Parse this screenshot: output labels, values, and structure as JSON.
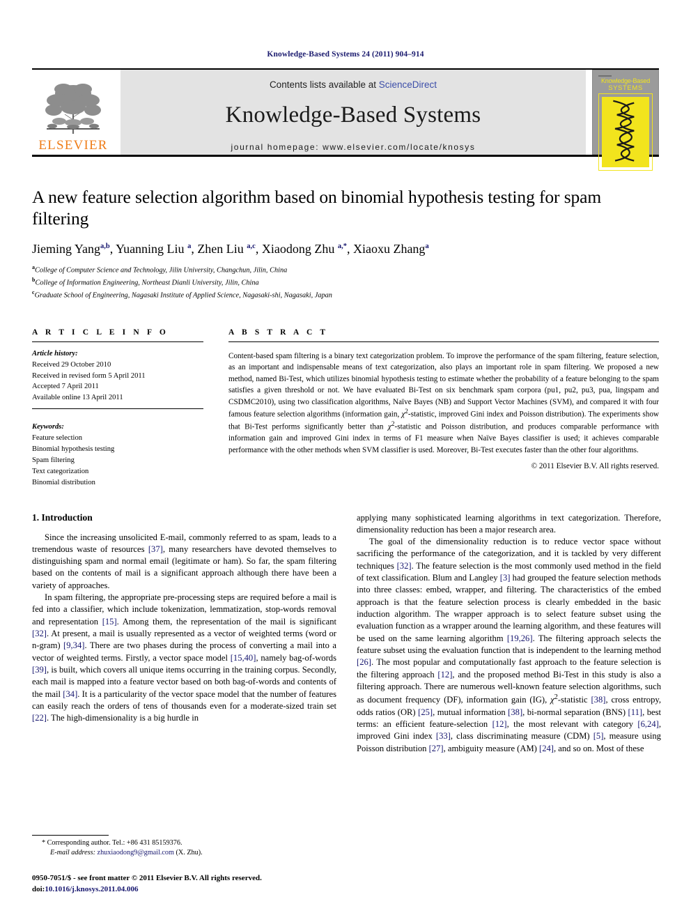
{
  "running_head": "Knowledge-Based Systems 24 (2011) 904–914",
  "masthead": {
    "contents_prefix": "Contents lists available at ",
    "sciencedirect": "ScienceDirect",
    "journal_name": "Knowledge-Based Systems",
    "homepage": "journal homepage: www.elsevier.com/locate/knosys",
    "publisher_wordmark": "ELSEVIER",
    "cover": {
      "line1": "Knowledge-Based",
      "line2": "SYSTEMS"
    }
  },
  "article": {
    "title": "A new feature selection algorithm based on binomial hypothesis testing for spam filtering",
    "authors_html": "Jieming Yang <sup>a,b</sup>, Yuanning Liu <sup>a</sup>, Zhen Liu <sup>a,c</sup>, Xiaodong Zhu <sup>a,</sup><sup>*</sup>, Xiaoxu Zhang <sup>a</sup>",
    "affiliations": [
      "College of Computer Science and Technology, Jilin University, Changchun, Jilin, China",
      "College of Information Engineering, Northeast Dianli University, Jilin, China",
      "Graduate School of Engineering, Nagasaki Institute of Applied Science, Nagasaki-shi, Nagasaki, Japan"
    ],
    "affiliation_marks": [
      "a",
      "b",
      "c"
    ]
  },
  "info": {
    "heading": "A R T I C L E   I N F O",
    "history_label": "Article history:",
    "history": [
      "Received 29 October 2010",
      "Received in revised form 5 April 2011",
      "Accepted 7 April 2011",
      "Available online 13 April 2011"
    ],
    "keywords_label": "Keywords:",
    "keywords": [
      "Feature selection",
      "Binomial hypothesis testing",
      "Spam filtering",
      "Text categorization",
      "Binomial distribution"
    ]
  },
  "abstract": {
    "heading": "A B S T R A C T",
    "text_html": "Content-based spam filtering is a binary text categorization problem. To improve the performance of the spam filtering, feature selection, as an important and indispensable means of text categorization, also plays an important role in spam filtering. We proposed a new method, named Bi-Test, which utilizes binomial hypothesis testing to estimate whether the probability of a feature belonging to the spam satisfies a given threshold or not. We have evaluated Bi-Test on six benchmark spam corpora (pu1, pu2, pu3, pua, lingspam and CSDMC2010), using two classification algorithms, Naïve Bayes (NB) and Support Vector Machines (SVM), and compared it with four famous feature selection algorithms (information gain, <span class=\"chi\">&chi;</span><sup>2</sup>-statistic, improved Gini index and Poisson distribution). The experiments show that Bi-Test performs significantly better than <span class=\"chi\">&chi;</span><sup>2</sup>-statistic and Poisson distribution, and produces comparable performance with information gain and improved Gini index in terms of F1 measure when Naïve Bayes classifier is used; it achieves comparable performance with the other methods when SVM classifier is used. Moreover, Bi-Test executes faster than the other four algorithms.",
    "copyright": "© 2011 Elsevier B.V. All rights reserved."
  },
  "body": {
    "section_heading": "1. Introduction",
    "left_paragraphs_html": [
      "Since the increasing unsolicited E-mail, commonly referred to as spam, leads to a tremendous waste of resources <span class=\"ref\">[37]</span>, many researchers have devoted themselves to distinguishing spam and normal email (legitimate or ham). So far, the spam filtering based on the contents of mail is a significant approach although there have been a variety of approaches.",
      "In spam filtering, the appropriate pre-processing steps are required before a mail is fed into a classifier, which include tokenization, lemmatization, stop-words removal and representation <span class=\"ref\">[15]</span>. Among them, the representation of the mail is significant <span class=\"ref\">[32]</span>. At present, a mail is usually represented as a vector of weighted terms (word or n-gram) <span class=\"ref\">[9,34]</span>. There are two phases during the process of converting a mail into a vector of weighted terms. Firstly, a vector space model <span class=\"ref\">[15,40]</span>, namely bag-of-words <span class=\"ref\">[39]</span>, is built, which covers all unique items occurring in the training corpus. Secondly, each mail is mapped into a feature vector based on both bag-of-words and contents of the mail <span class=\"ref\">[34]</span>. It is a particularity of the vector space model that the number of features can easily reach the orders of tens of thousands even for a moderate-sized train set <span class=\"ref\">[22]</span>. The high-dimensionality is a big hurdle in"
    ],
    "right_paragraphs_html": [
      "applying many sophisticated learning algorithms in text categorization. Therefore, dimensionality reduction has been a major research area.",
      "The goal of the dimensionality reduction is to reduce vector space without sacrificing the performance of the categorization, and it is tackled by very different techniques <span class=\"ref\">[32]</span>. The feature selection is the most commonly used method in the field of text classification. Blum and Langley <span class=\"ref\">[3]</span> had grouped the feature selection methods into three classes: embed, wrapper, and filtering. The characteristics of the embed approach is that the feature selection process is clearly embedded in the basic induction algorithm. The wrapper approach is to select feature subset using the evaluation function as a wrapper around the learning algorithm, and these features will be used on the same learning algorithm <span class=\"ref\">[19,26]</span>. The filtering approach selects the feature subset using the evaluation function that is independent to the learning method <span class=\"ref\">[26]</span>. The most popular and computationally fast approach to the feature selection is the filtering approach <span class=\"ref\">[12]</span>, and the proposed method Bi-Test in this study is also a filtering approach. There are numerous well-known feature selection algorithms, such as document frequency (DF), information gain (IG), <span class=\"chi\">&chi;</span><sup>2</sup>-statistic <span class=\"ref\">[38]</span>, cross entropy, odds ratios (OR) <span class=\"ref\">[25]</span>, mutual information <span class=\"ref\">[38]</span>, bi-normal separation (BNS) <span class=\"ref\">[11]</span>, best terms: an efficient feature-selection <span class=\"ref\">[12]</span>, the most relevant with category <span class=\"ref\">[6,24]</span>, improved Gini index <span class=\"ref\">[33]</span>, class discriminating measure (CDM) <span class=\"ref\">[5]</span>, measure using Poisson distribution <span class=\"ref\">[27]</span>, ambiguity measure (AM) <span class=\"ref\">[24]</span>, and so on. Most of these"
    ]
  },
  "footnotes": {
    "corresponding_html": "* Corresponding author. Tel.: +86 431 85159376.",
    "email_label": "E-mail address:",
    "email": "zhuxiaodong9@gmail.com",
    "email_suffix": "(X. Zhu).",
    "issn_html": "0950-7051/$ - see front matter © 2011 Elsevier B.V. All rights reserved.",
    "doi_label": "doi:",
    "doi": "10.1016/j.knosys.2011.04.006"
  },
  "colors": {
    "link_blue": "#16166e",
    "sciencedirect_blue": "#3b4da8",
    "elsevier_orange": "#ef7d18",
    "band_gray": "#e3e3e3",
    "cover_yellow": "#f2e41d"
  }
}
